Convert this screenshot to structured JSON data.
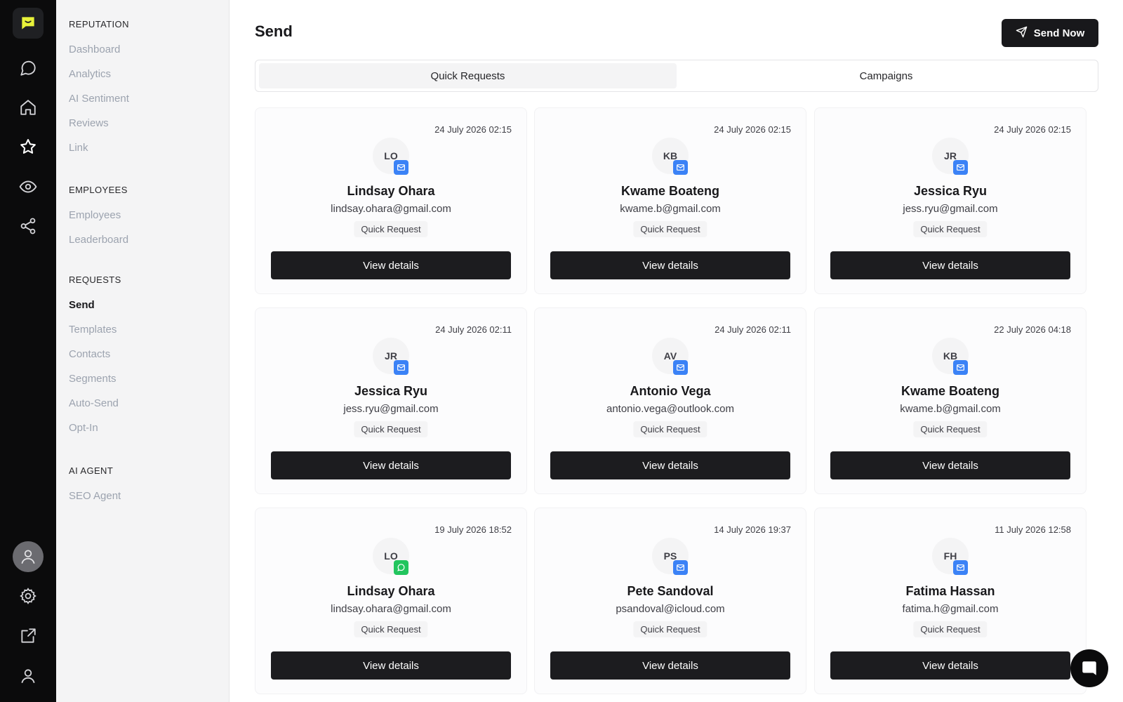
{
  "rail": {
    "icons": [
      "logo-chat-icon",
      "messages-icon",
      "home-icon",
      "star-icon",
      "eye-icon",
      "share-icon",
      "avatar-icon",
      "settings-icon",
      "external-link-icon",
      "user-icon"
    ],
    "accent": "#e8f23a"
  },
  "sidebar": {
    "sections": [
      {
        "title": "REPUTATION",
        "items": [
          "Dashboard",
          "Analytics",
          "AI Sentiment",
          "Reviews",
          "Link"
        ]
      },
      {
        "title": "EMPLOYEES",
        "items": [
          "Employees",
          "Leaderboard"
        ]
      },
      {
        "title": "REQUESTS",
        "items": [
          "Send",
          "Templates",
          "Contacts",
          "Segments",
          "Auto-Send",
          "Opt-In"
        ]
      },
      {
        "title": "AI AGENT",
        "items": [
          "SEO Agent"
        ]
      }
    ],
    "active": "Send"
  },
  "header": {
    "title": "Send",
    "send_now_label": "Send Now"
  },
  "tabs": [
    {
      "label": "Quick Requests",
      "selected": true
    },
    {
      "label": "Campaigns",
      "selected": false
    }
  ],
  "cards": [
    {
      "date": "24 July 2026 02:15",
      "initials": "LO",
      "channel": "email",
      "name": "Lindsay Ohara",
      "email": "lindsay.ohara@gmail.com",
      "badge": "Quick Request",
      "button": "View details"
    },
    {
      "date": "24 July 2026 02:15",
      "initials": "KB",
      "channel": "email",
      "name": "Kwame Boateng",
      "email": "kwame.b@gmail.com",
      "badge": "Quick Request",
      "button": "View details"
    },
    {
      "date": "24 July 2026 02:15",
      "initials": "JR",
      "channel": "email",
      "name": "Jessica Ryu",
      "email": "jess.ryu@gmail.com",
      "badge": "Quick Request",
      "button": "View details"
    },
    {
      "date": "24 July 2026 02:11",
      "initials": "JR",
      "channel": "email",
      "name": "Jessica Ryu",
      "email": "jess.ryu@gmail.com",
      "badge": "Quick Request",
      "button": "View details"
    },
    {
      "date": "24 July 2026 02:11",
      "initials": "AV",
      "channel": "email",
      "name": "Antonio Vega",
      "email": "antonio.vega@outlook.com",
      "badge": "Quick Request",
      "button": "View details"
    },
    {
      "date": "22 July 2026 04:18",
      "initials": "KB",
      "channel": "email",
      "name": "Kwame Boateng",
      "email": "kwame.b@gmail.com",
      "badge": "Quick Request",
      "button": "View details"
    },
    {
      "date": "19 July 2026 18:52",
      "initials": "LO",
      "channel": "whatsapp",
      "name": "Lindsay Ohara",
      "email": "lindsay.ohara@gmail.com",
      "badge": "Quick Request",
      "button": "View details"
    },
    {
      "date": "14 July 2026 19:37",
      "initials": "PS",
      "channel": "email",
      "name": "Pete Sandoval",
      "email": "psandoval@icloud.com",
      "badge": "Quick Request",
      "button": "View details"
    },
    {
      "date": "11 July 2026 12:58",
      "initials": "FH",
      "channel": "email",
      "name": "Fatima Hassan",
      "email": "fatima.h@gmail.com",
      "badge": "Quick Request",
      "button": "View details"
    }
  ],
  "colors": {
    "email_channel": "#3b82f6",
    "whatsapp_channel": "#22c55e",
    "primary_button": "#18181b"
  }
}
